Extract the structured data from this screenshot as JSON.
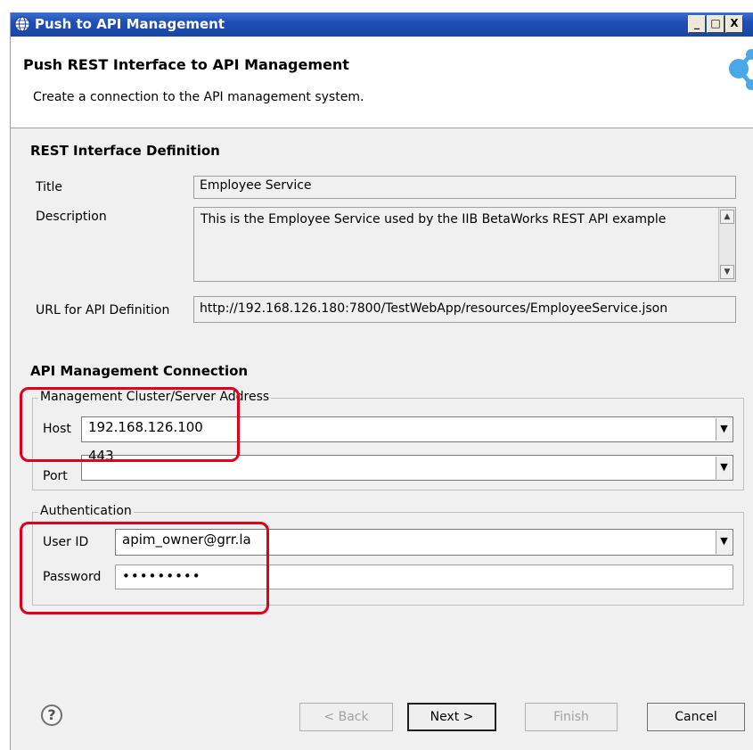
{
  "window": {
    "title": "Push to API Management",
    "controls": {
      "minimize": "_",
      "maximize": "□",
      "close": "X"
    }
  },
  "header": {
    "title": "Push REST Interface to API Management",
    "subtitle": "Create a connection to the API management system.",
    "logo_icon": "share-nodes-icon"
  },
  "rest_definition": {
    "section_title": "REST Interface Definition",
    "title_label": "Title",
    "title_value": "Employee Service",
    "description_label": "Description",
    "description_value": "This is the Employee Service used by the IIB BetaWorks REST API example",
    "url_label": "URL for API Definition",
    "url_value": "http://192.168.126.180:7800/TestWebApp/resources/EmployeeService.json"
  },
  "connection": {
    "section_title": "API Management Connection",
    "server_group_label": "Management Cluster/Server Address",
    "host_label": "Host",
    "host_value": "192.168.126.100",
    "port_label": "Port",
    "port_value": "443",
    "auth_group_label": "Authentication",
    "userid_label": "User ID",
    "userid_value": "apim_owner@grr.la",
    "password_label": "Password",
    "password_value": "•••••••••"
  },
  "buttons": {
    "back": "< Back",
    "next": "Next >",
    "finish": "Finish",
    "cancel": "Cancel",
    "help": "?"
  },
  "colors": {
    "titlebar": "#1f4fb4",
    "highlight": "#e0001a",
    "dialog_bg": "#f0f0f0"
  }
}
